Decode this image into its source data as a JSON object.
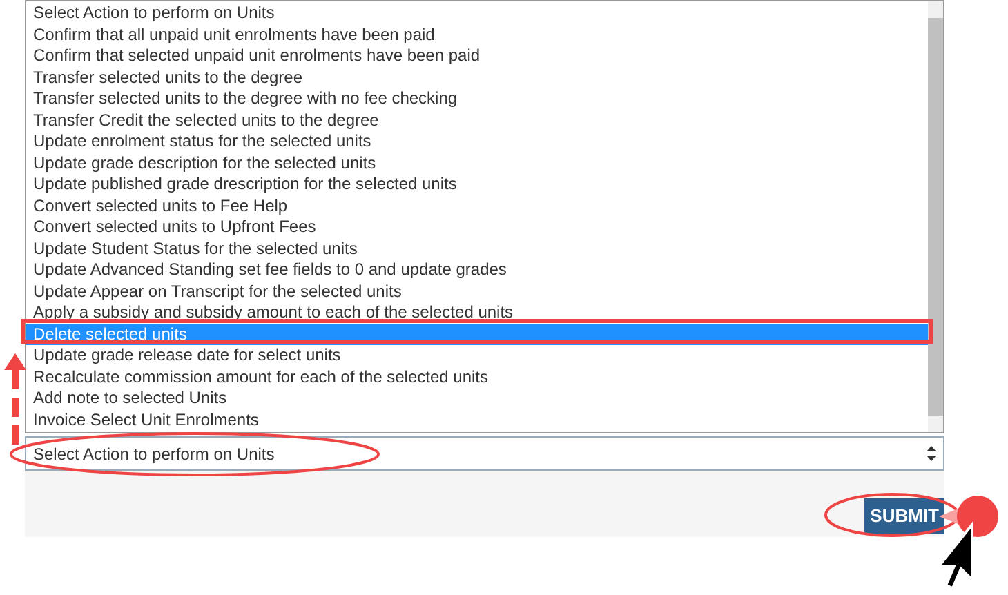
{
  "action_list": {
    "options": [
      {
        "label": "Select Action to perform on Units",
        "selected": false
      },
      {
        "label": "Confirm that all unpaid unit enrolments have been paid",
        "selected": false
      },
      {
        "label": "Confirm that selected unpaid unit enrolments have been paid",
        "selected": false
      },
      {
        "label": "Transfer selected units to the degree",
        "selected": false
      },
      {
        "label": "Transfer selected units to the degree with no fee checking",
        "selected": false
      },
      {
        "label": "Transfer Credit the selected units to the degree",
        "selected": false
      },
      {
        "label": "Update enrolment status for the selected units",
        "selected": false
      },
      {
        "label": "Update grade description for the selected units",
        "selected": false
      },
      {
        "label": "Update published grade drescription for the selected units",
        "selected": false
      },
      {
        "label": "Convert selected units to Fee Help",
        "selected": false
      },
      {
        "label": "Convert selected units to Upfront Fees",
        "selected": false
      },
      {
        "label": "Update Student Status for the selected units",
        "selected": false
      },
      {
        "label": "Update Advanced Standing set fee fields to 0 and update grades",
        "selected": false
      },
      {
        "label": "Update Appear on Transcript for the selected units",
        "selected": false
      },
      {
        "label": "Apply a subsidy and subsidy amount to each of the selected units",
        "selected": false
      },
      {
        "label": "Delete selected units",
        "selected": true
      },
      {
        "label": "Update grade release date for select units",
        "selected": false
      },
      {
        "label": "Recalculate commission amount for each of the selected units",
        "selected": false
      },
      {
        "label": "Add note to selected Units",
        "selected": false
      },
      {
        "label": "Invoice Select Unit Enrolments",
        "selected": false
      }
    ]
  },
  "action_select": {
    "value": "Select Action to perform on Units"
  },
  "submit_button": {
    "label": "SUBMIT"
  }
}
